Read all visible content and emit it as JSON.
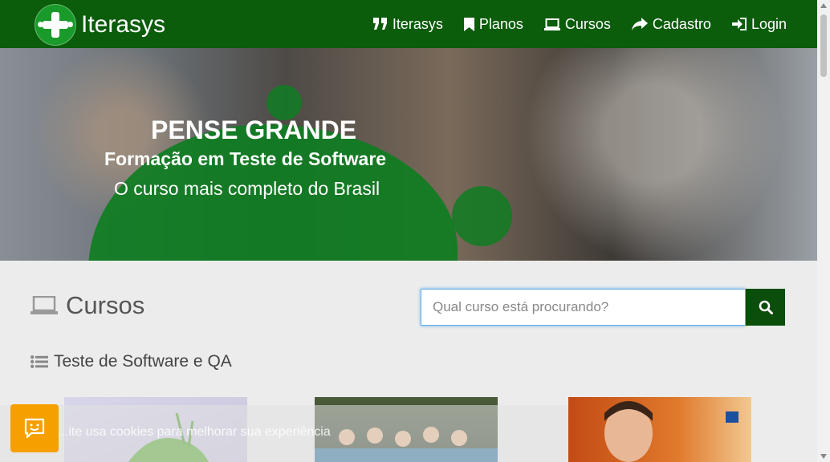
{
  "brand": {
    "name": "Iterasys"
  },
  "nav": [
    {
      "label": "Iterasys",
      "icon": "quote-icon"
    },
    {
      "label": "Planos",
      "icon": "bookmark-icon"
    },
    {
      "label": "Cursos",
      "icon": "laptop-icon"
    },
    {
      "label": "Cadastro",
      "icon": "share-arrow-icon"
    },
    {
      "label": "Login",
      "icon": "sign-in-icon"
    }
  ],
  "hero": {
    "title": "PENSE GRANDE",
    "subtitle": "Formação em Teste de Software",
    "tagline": "O curso mais completo do Brasil"
  },
  "courses": {
    "title": "Cursos",
    "search_placeholder": "Qual curso está procurando?",
    "category": "Teste de Software e QA"
  },
  "cookie": {
    "text": "...ite usa cookies para melhorar sua experiência"
  },
  "colors": {
    "nav_bg": "#0b5c0b",
    "accent": "#0f7d22",
    "feedback": "#f5a000"
  }
}
